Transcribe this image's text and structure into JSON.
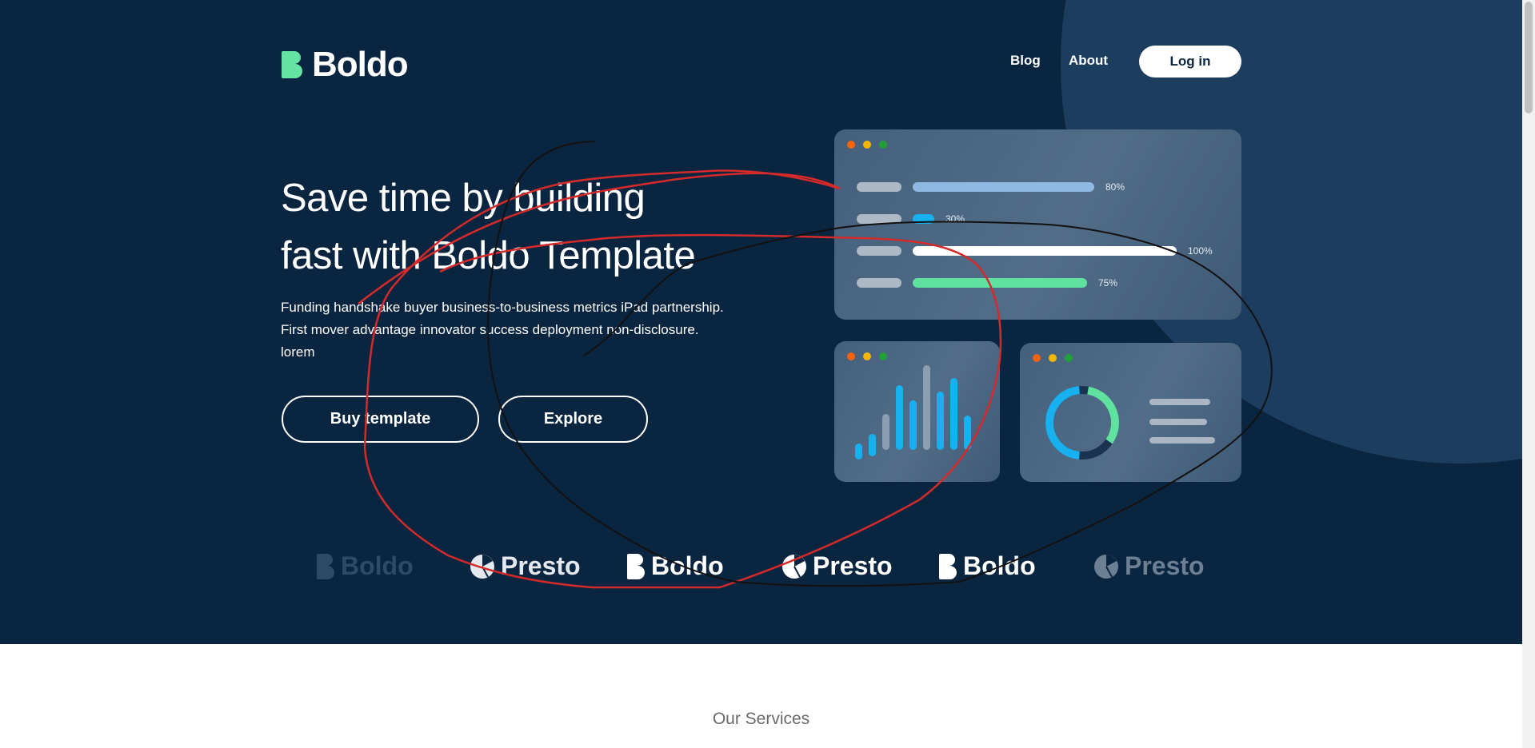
{
  "brand": {
    "name": "Boldo",
    "accent": "#65e4a3",
    "bg": "#0a2540"
  },
  "nav": {
    "blog": "Blog",
    "about": "About",
    "login": "Log in"
  },
  "hero": {
    "headline_line1": "Save time by building",
    "headline_line2": "fast with Boldo Template",
    "desc_line1": "Funding handshake buyer business-to-business metrics iPad partnership.",
    "desc_line2": "First mover advantage innovator success deployment non-disclosure.",
    "desc_line3": "lorem",
    "buy_button": "Buy template",
    "explore_button": "Explore"
  },
  "dashboard": {
    "progress": [
      {
        "label": "80%",
        "value": 0.8,
        "color": "#8fb9e3"
      },
      {
        "label": "30%",
        "value": 0.3,
        "color": "#16b1ee"
      },
      {
        "label": "100%",
        "value": 1.0,
        "color": "#ffffff"
      },
      {
        "label": "75%",
        "value": 0.75,
        "color": "#5fe1a0"
      }
    ],
    "columns": [
      {
        "value": 0.18,
        "color": "#16b1ee"
      },
      {
        "value": 0.25,
        "color": "#16b1ee"
      },
      {
        "value": 0.4,
        "color": "#8a9fb3"
      },
      {
        "value": 0.72,
        "color": "#16b1ee"
      },
      {
        "value": 0.55,
        "color": "#16b1ee"
      },
      {
        "value": 0.95,
        "color": "#8a9fb3"
      },
      {
        "value": 0.65,
        "color": "#16b1ee"
      },
      {
        "value": 0.8,
        "color": "#16b1ee"
      },
      {
        "value": 0.38,
        "color": "#16b1ee"
      }
    ],
    "donut": {
      "primary": "#16b1ee",
      "secondary": "#5fe1a0",
      "track": "#1a3350"
    }
  },
  "logos": [
    {
      "name": "Boldo",
      "type": "boldo",
      "color": "#2f4a66"
    },
    {
      "name": "Presto",
      "type": "presto",
      "color": "#e4e9ef"
    },
    {
      "name": "Boldo",
      "type": "boldo",
      "color": "#ffffff"
    },
    {
      "name": "Presto",
      "type": "presto",
      "color": "#ffffff"
    },
    {
      "name": "Boldo",
      "type": "boldo",
      "color": "#ffffff"
    },
    {
      "name": "Presto",
      "type": "presto",
      "color": "#6d7f92"
    }
  ],
  "services": {
    "title": "Our Services"
  }
}
